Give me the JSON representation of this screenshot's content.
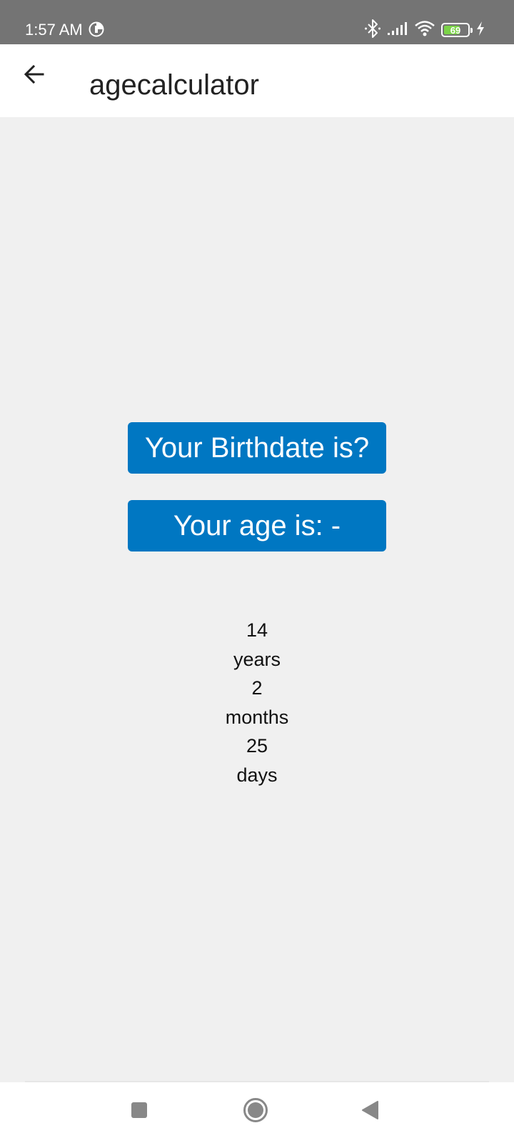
{
  "status_bar": {
    "time": "1:57 AM",
    "battery_level": "69",
    "battery_fraction": 0.69,
    "battery_fill_color": "#7bd348",
    "icons": [
      "sync-icon",
      "bluetooth-icon",
      "signal-icon",
      "wifi-icon",
      "battery-icon",
      "charging-bolt-icon"
    ]
  },
  "app_bar": {
    "title": "agecalculator",
    "back_icon": "arrow-left-icon"
  },
  "main": {
    "birthdate_button_label": "Your Birthdate is?",
    "age_button_label": "Your age is: -",
    "button_color": "#0077c2",
    "result": {
      "years_value": "14",
      "years_label": "years",
      "months_value": "2",
      "months_label": "months",
      "days_value": "25",
      "days_label": "days"
    }
  },
  "nav_bar": {
    "icons": [
      "recent-apps-icon",
      "home-icon",
      "back-icon"
    ]
  }
}
